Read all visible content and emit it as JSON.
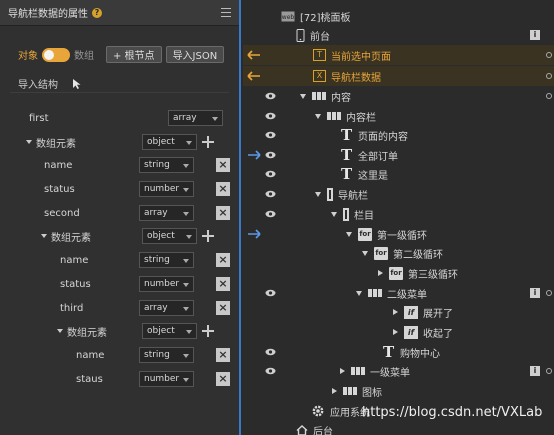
{
  "left_panel": {
    "title": "导航栏数据的属性",
    "mode_object": "对象",
    "mode_array": "数组",
    "add_root_label": "+ 根节点",
    "import_json_label": "导入JSON",
    "import_structure_label": "导入结构",
    "fields": [
      {
        "name": "first",
        "type": "array"
      },
      {
        "name": "数组元素",
        "type": "object"
      },
      {
        "name": "name",
        "type": "string"
      },
      {
        "name": "status",
        "type": "number"
      },
      {
        "name": "second",
        "type": "array"
      },
      {
        "name": "数组元素",
        "type": "object"
      },
      {
        "name": "name",
        "type": "string"
      },
      {
        "name": "status",
        "type": "number"
      },
      {
        "name": "third",
        "type": "array"
      },
      {
        "name": "数组元素",
        "type": "object"
      },
      {
        "name": "name",
        "type": "string"
      },
      {
        "name": "staus",
        "type": "number"
      }
    ]
  },
  "tree": {
    "nodes": [
      "[72]桃面板",
      "前台",
      "当前选中页面",
      "导航栏数据",
      "内容",
      "内容栏",
      "页面的内容",
      "全部订单",
      "这里是",
      "导航栏",
      "栏目",
      "第一级循环",
      "第二级循环",
      "第三级循环",
      "二级菜单",
      "展开了",
      "收起了",
      "购物中心",
      "一级菜单",
      "图标",
      "应用系统",
      "后台"
    ],
    "icon_labels": {
      "text": "T",
      "variable": "X",
      "loop": "for",
      "condition": "if",
      "info": "i"
    }
  },
  "watermark": "https://blog.csdn.net/VXLab",
  "colors": {
    "accent": "#e8a63a",
    "selection": "#3a78c9"
  }
}
